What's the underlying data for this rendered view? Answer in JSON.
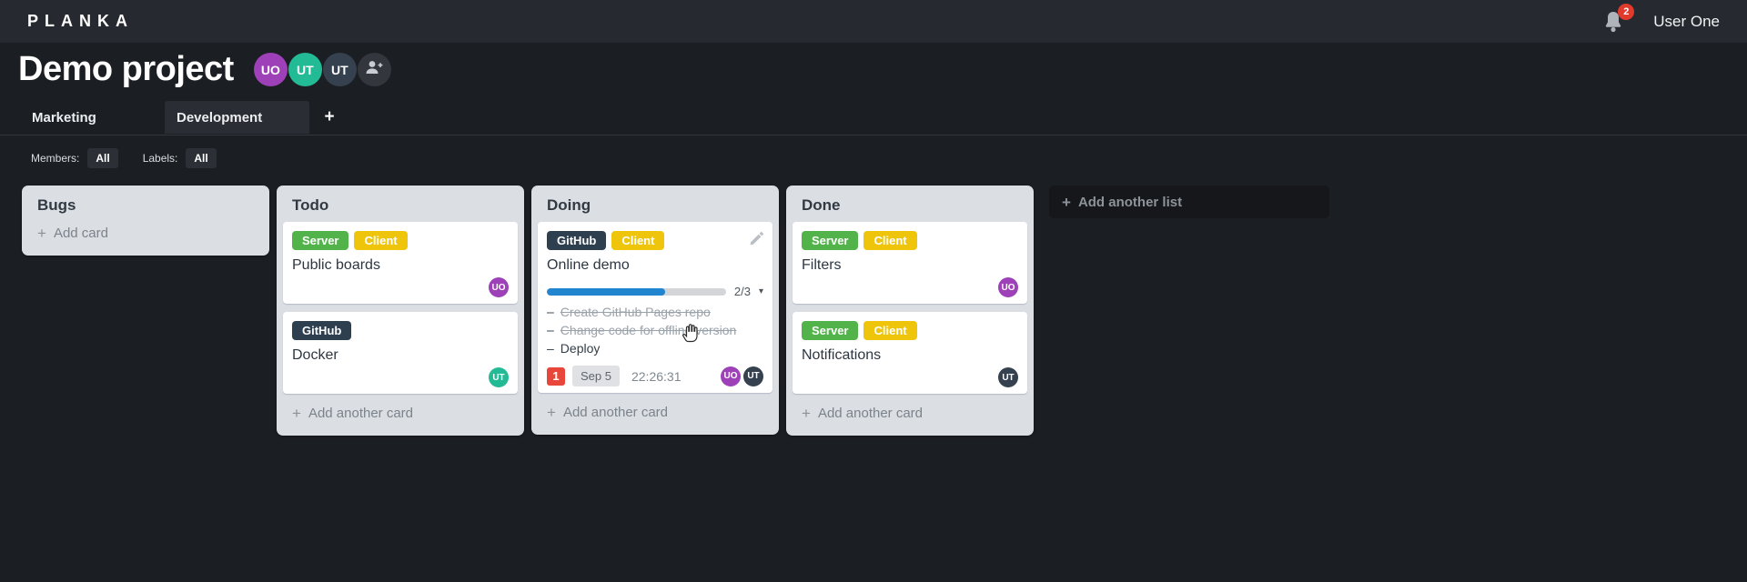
{
  "glyphs": {
    "plus": "+",
    "caret_down": "▾",
    "dash": "–"
  },
  "colors": {
    "label_green": "#52b34a",
    "label_yellow": "#eec50a",
    "label_navy": "#2e3f50",
    "avatar_purple": "#9e41b8",
    "avatar_teal": "#23bb96",
    "avatar_darknavy": "#35414f",
    "progress_blue": "#2185d0",
    "badge_red": "#e8463b"
  },
  "topbar": {
    "logo": "PLANKA",
    "notification_count": "2",
    "user_name": "User One"
  },
  "header": {
    "title": "Demo project",
    "members": [
      {
        "initials": "UO"
      },
      {
        "initials": "UT"
      },
      {
        "initials": "UT"
      }
    ]
  },
  "tabs": {
    "items": [
      {
        "label": "Marketing",
        "active": false
      },
      {
        "label": "Development",
        "active": true
      }
    ]
  },
  "filters": {
    "members_label": "Members:",
    "members_value": "All",
    "labels_label": "Labels:",
    "labels_value": "All"
  },
  "board": {
    "add_list_label": "Add another list",
    "lists": [
      {
        "name": "Bugs",
        "add_label": "Add card",
        "cards": []
      },
      {
        "name": "Todo",
        "add_label": "Add another card",
        "cards": [
          {
            "title": "Public boards",
            "labels": [
              {
                "text": "Server"
              },
              {
                "text": "Client"
              }
            ],
            "members": [
              {
                "initials": "UO"
              }
            ]
          },
          {
            "title": "Docker",
            "labels": [
              {
                "text": "GitHub"
              }
            ],
            "members": [
              {
                "initials": "UT"
              }
            ]
          }
        ]
      },
      {
        "name": "Doing",
        "add_label": "Add another card",
        "cards": [
          {
            "title": "Online demo",
            "labels": [
              {
                "text": "GitHub"
              },
              {
                "text": "Client"
              }
            ],
            "progress": {
              "done": 2,
              "total": 3,
              "label": "2/3",
              "percent": "66%"
            },
            "tasks": [
              {
                "text": "Create GitHub Pages repo",
                "completed": true
              },
              {
                "text": "Change code for offline version",
                "completed": true
              },
              {
                "text": "Deploy",
                "completed": false
              }
            ],
            "badges": {
              "count": "1",
              "due_date": "Sep 5",
              "timer": "22:26:31"
            },
            "members": [
              {
                "initials": "UO"
              },
              {
                "initials": "UT"
              }
            ]
          }
        ]
      },
      {
        "name": "Done",
        "add_label": "Add another card",
        "cards": [
          {
            "title": "Filters",
            "labels": [
              {
                "text": "Server"
              },
              {
                "text": "Client"
              }
            ],
            "members": [
              {
                "initials": "UO"
              }
            ]
          },
          {
            "title": "Notifications",
            "labels": [
              {
                "text": "Server"
              },
              {
                "text": "Client"
              }
            ],
            "members": [
              {
                "initials": "UT"
              }
            ]
          }
        ]
      }
    ]
  }
}
